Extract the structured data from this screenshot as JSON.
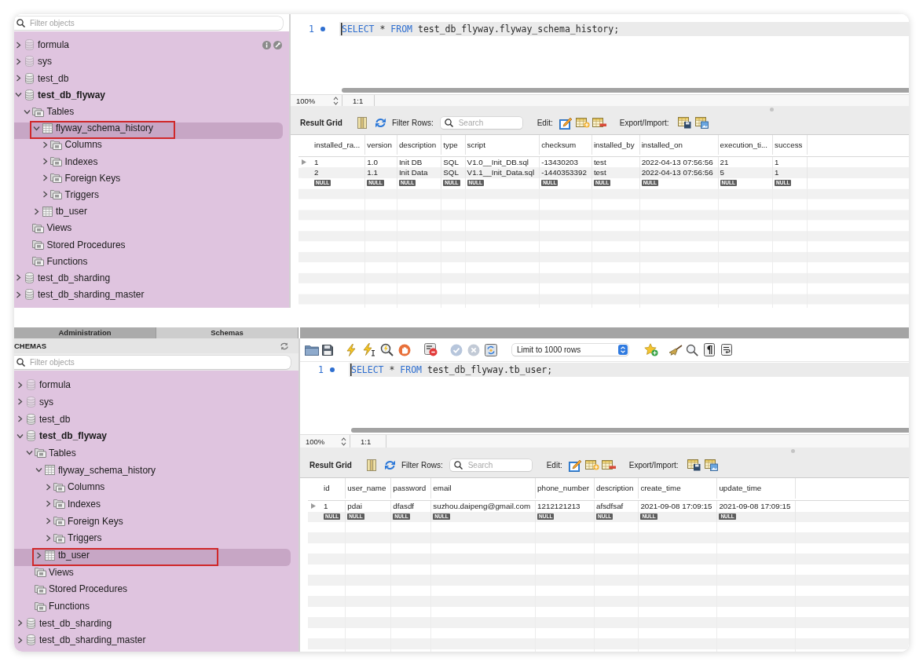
{
  "captures": [
    {
      "sidebar": {
        "filter": {
          "placeholder": "Filter objects"
        },
        "tree": [
          {
            "label": "formula",
            "kind": "schema",
            "expanded": false,
            "selected": false,
            "active": false,
            "faded": true,
            "hovered": true
          },
          {
            "label": "sys",
            "kind": "schema",
            "expanded": false,
            "selected": false,
            "active": false,
            "faded": true
          },
          {
            "label": "test_db",
            "kind": "schema",
            "expanded": false,
            "selected": false,
            "active": false
          },
          {
            "label": "test_db_flyway",
            "kind": "schema",
            "expanded": true,
            "selected": false,
            "active": true,
            "children": [
              {
                "label": "Tables",
                "kind": "folder",
                "expanded": true,
                "selected": false,
                "children": [
                  {
                    "label": "flyway_schema_history",
                    "kind": "table",
                    "expanded": true,
                    "selected": true,
                    "annotated": true,
                    "children": [
                      {
                        "label": "Columns",
                        "kind": "folder",
                        "expanded": false,
                        "selected": false
                      },
                      {
                        "label": "Indexes",
                        "kind": "folder",
                        "expanded": false,
                        "selected": false
                      },
                      {
                        "label": "Foreign Keys",
                        "kind": "folder",
                        "expanded": false,
                        "selected": false
                      },
                      {
                        "label": "Triggers",
                        "kind": "folder",
                        "expanded": false,
                        "selected": false
                      }
                    ]
                  },
                  {
                    "label": "tb_user",
                    "kind": "table",
                    "expanded": false,
                    "selected": false
                  }
                ]
              },
              {
                "label": "Views",
                "kind": "folder",
                "selected": false
              },
              {
                "label": "Stored Procedures",
                "kind": "folder",
                "selected": false
              },
              {
                "label": "Functions",
                "kind": "folder",
                "selected": false
              }
            ]
          },
          {
            "label": "test_db_sharding",
            "kind": "schema",
            "expanded": false,
            "selected": false,
            "active": false
          },
          {
            "label": "test_db_sharding_master",
            "kind": "schema",
            "expanded": false,
            "selected": false,
            "active": false
          }
        ]
      },
      "editor": {
        "line_number": "1",
        "code": [
          {
            "kind": "keyword",
            "text": "SELECT"
          },
          {
            "kind": "operator",
            "text": " * "
          },
          {
            "kind": "keyword",
            "text": "FROM"
          },
          {
            "kind": "identifier",
            "text": " test_db_flyway.flyway_schema_history;"
          }
        ]
      },
      "status_bar": {
        "zoom": "100%",
        "position": "1:1"
      },
      "result_toolbar": {
        "view_tab": "Result Grid",
        "filter_label": "Filter Rows:",
        "search": {
          "placeholder": "Search"
        },
        "edit_label": "Edit:",
        "export_label": "Export/Import:"
      },
      "result_grid": {
        "columns": [
          "installed_ra...",
          "version",
          "description",
          "type",
          "script",
          "checksum",
          "installed_by",
          "installed_on",
          "execution_ti...",
          "success"
        ],
        "rows": [
          {
            "kind": "data",
            "current": true,
            "cells": [
              "1",
              "1.0",
              "Init DB",
              "SQL",
              "V1.0__Init_DB.sql",
              "-13430203",
              "test",
              "2022-04-13 07:56:56",
              "21",
              "1"
            ]
          },
          {
            "kind": "data",
            "current": false,
            "cells": [
              "2",
              "1.1",
              "Init Data",
              "SQL",
              "V1.1__Init_Data.sql",
              "-1440353392",
              "test",
              "2022-04-13 07:56:56",
              "5",
              "1"
            ]
          },
          {
            "kind": "null",
            "current": false,
            "cells": [
              "NULL",
              "NULL",
              "NULL",
              "NULL",
              "NULL",
              "NULL",
              "NULL",
              "NULL",
              "NULL",
              "NULL"
            ]
          }
        ]
      }
    },
    {
      "tabs": [
        {
          "label": "Administration",
          "selected": false
        },
        {
          "label": "Schemas",
          "selected": true
        }
      ],
      "sidebar": {
        "title": "CHEMAS",
        "filter": {
          "placeholder": "Filter objects"
        },
        "tree": [
          {
            "label": "formula",
            "kind": "schema",
            "expanded": false,
            "selected": false,
            "active": false,
            "faded": true
          },
          {
            "label": "sys",
            "kind": "schema",
            "expanded": false,
            "selected": false,
            "active": false,
            "faded": true
          },
          {
            "label": "test_db",
            "kind": "schema",
            "expanded": false,
            "selected": false,
            "active": false
          },
          {
            "label": "test_db_flyway",
            "kind": "schema",
            "expanded": true,
            "selected": false,
            "active": true,
            "children": [
              {
                "label": "Tables",
                "kind": "folder",
                "expanded": true,
                "selected": false,
                "children": [
                  {
                    "label": "flyway_schema_history",
                    "kind": "table",
                    "expanded": true,
                    "selected": false,
                    "children": [
                      {
                        "label": "Columns",
                        "kind": "folder",
                        "expanded": false,
                        "selected": false
                      },
                      {
                        "label": "Indexes",
                        "kind": "folder",
                        "expanded": false,
                        "selected": false
                      },
                      {
                        "label": "Foreign Keys",
                        "kind": "folder",
                        "expanded": false,
                        "selected": false
                      },
                      {
                        "label": "Triggers",
                        "kind": "folder",
                        "expanded": false,
                        "selected": false
                      }
                    ]
                  },
                  {
                    "label": "tb_user",
                    "kind": "table",
                    "expanded": false,
                    "selected": true,
                    "annotated": true
                  }
                ]
              },
              {
                "label": "Views",
                "kind": "folder",
                "selected": false
              },
              {
                "label": "Stored Procedures",
                "kind": "folder",
                "selected": false
              },
              {
                "label": "Functions",
                "kind": "folder",
                "selected": false
              }
            ]
          },
          {
            "label": "test_db_sharding",
            "kind": "schema",
            "expanded": false,
            "selected": false,
            "active": false
          },
          {
            "label": "test_db_sharding_master",
            "kind": "schema",
            "expanded": false,
            "selected": false,
            "active": false
          }
        ]
      },
      "editor_toolbar": {
        "row_limit": "Limit to 1000 rows"
      },
      "editor": {
        "line_number": "1",
        "code": [
          {
            "kind": "keyword",
            "text": "SELECT"
          },
          {
            "kind": "operator",
            "text": " * "
          },
          {
            "kind": "keyword",
            "text": "FROM"
          },
          {
            "kind": "identifier",
            "text": " test_db_flyway.tb_user;"
          }
        ]
      },
      "status_bar": {
        "zoom": "100%",
        "position": "1:1"
      },
      "result_toolbar": {
        "view_tab": "Result Grid",
        "filter_label": "Filter Rows:",
        "search": {
          "placeholder": "Search"
        },
        "edit_label": "Edit:",
        "export_label": "Export/Import:"
      },
      "result_grid": {
        "columns": [
          "id",
          "user_name",
          "password",
          "email",
          "phone_number",
          "description",
          "create_time",
          "update_time"
        ],
        "rows": [
          {
            "kind": "data",
            "current": true,
            "cells": [
              "1",
              "pdai",
              "dfasdf",
              "suzhou.daipeng@gmail.com",
              "1212121213",
              "afsdfsaf",
              "2021-09-08 17:09:15",
              "2021-09-08 17:09:15"
            ]
          },
          {
            "kind": "null",
            "current": false,
            "cells": [
              "NULL",
              "NULL",
              "NULL",
              "NULL",
              "NULL",
              "NULL",
              "NULL",
              "NULL"
            ]
          }
        ]
      }
    }
  ]
}
